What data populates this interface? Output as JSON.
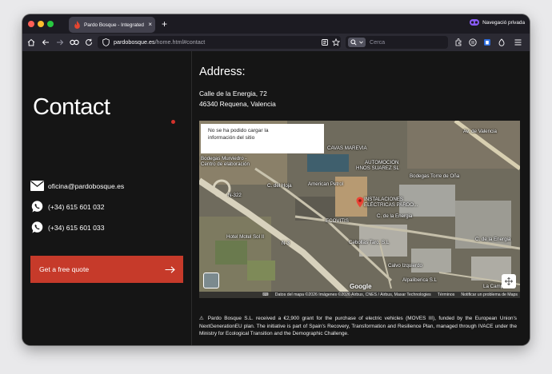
{
  "browser": {
    "tab_title": "Pardo Bosque - Integrated Elec",
    "private_label": "Navegació privada",
    "url_domain": "pardobosque.es",
    "url_path": "/home.html#contact",
    "search_placeholder": "Cerca"
  },
  "contact": {
    "title": "Contact",
    "email": "oficina@pardobosque.es",
    "phone_1": "(+34) 615 601 032",
    "phone_2": "(+34) 615 601 033",
    "quote_button": "Get a free quote"
  },
  "address": {
    "heading": "Address:",
    "line_1": "Calle de la Energia, 72",
    "line_2": "46340 Requena, Valencia"
  },
  "map": {
    "error_line_1": "No se ha podido cargar la",
    "error_line_2": "información del sitio",
    "labels": {
      "cavas_marevia": "CAVAS MAREVIA",
      "bodegas_murviedro": "Bodegas Murviedro -",
      "centro_elaboracion": "Centro de elaboración",
      "automocion": "AUTOMOCION",
      "hnos_suarez": "HNOS SUAREZ SL",
      "american_petrol": "American Petrol",
      "bodegas_torre": "Bodegas Torre de Oña",
      "instalaciones": "INSTALACIONES",
      "electricas_pardo": "ELÉCTRICAS PARDO...",
      "ecovitis": "ECOVITIS",
      "calle_dos": "C. de la Energia",
      "hotel_motel": "Hotel Motel Sol II",
      "cebollas": "Cebollas Taro, S.L",
      "calvo_izquierdo": "Calvo Izquierdo",
      "alpaliberica": "Alpaliberica S.L",
      "la_campana": "La Campana",
      "c_energia": "C. de la Energia",
      "n3": "N-3",
      "av_valencia": "Av. de Valencia",
      "calle_hoja": "C. del Hoja",
      "n322": "N-322"
    },
    "google": "Google",
    "footer_data": "Datos del mapa ©2026 Imágenes ©2026 Airbus, CNES / Airbus, Maxar Technologies",
    "footer_terms": "Términos",
    "footer_report": "Notificar un problema de Maps"
  },
  "grant_note": "⚠ Pardo Bosque S.L. received a €2,900 grant for the purchase of electric vehicles (MOVES III), funded by the European Union's NextGenerationEU plan. The initiative is part of Spain's Recovery, Transformation and Resilience Plan, managed through IVACE under the Ministry for Ecological Transition and the Demographic Challenge.",
  "colors": {
    "accent": "#c63a2a",
    "page_bg": "#151515",
    "chrome_bg": "#1c1b22"
  }
}
